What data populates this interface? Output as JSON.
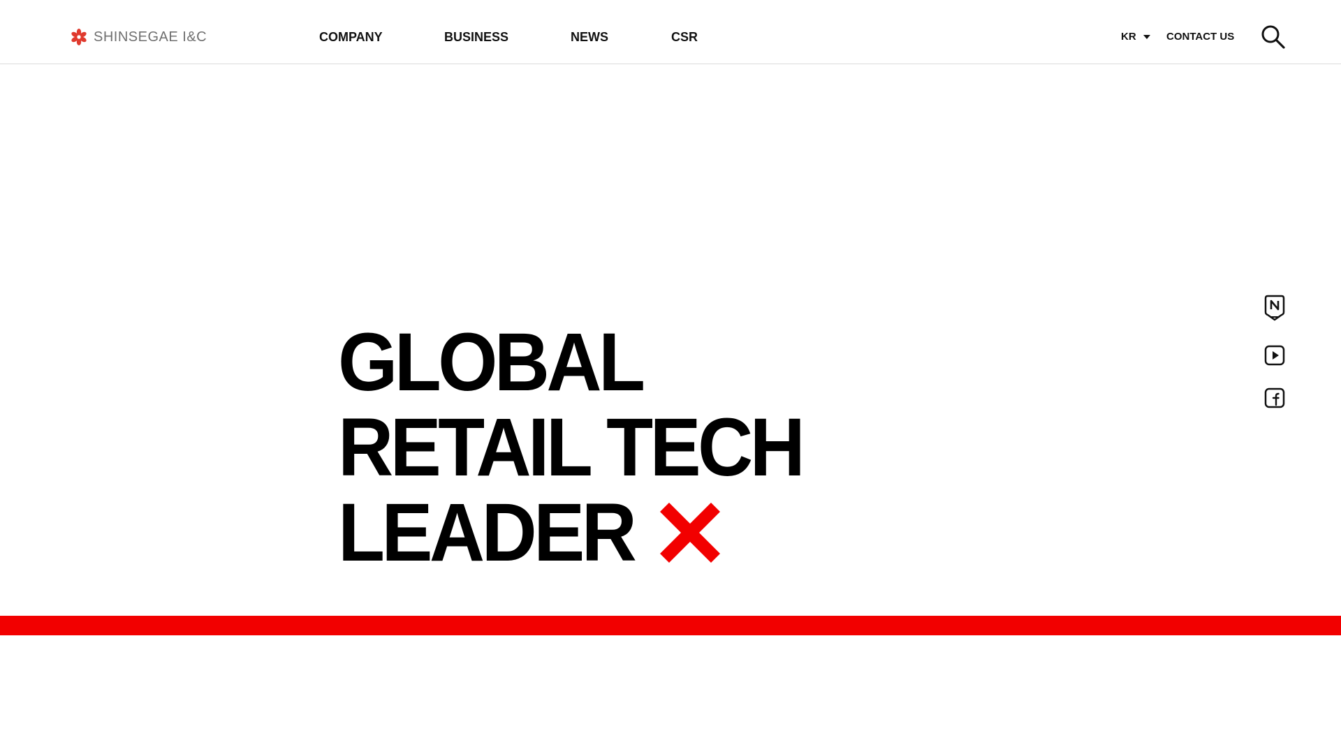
{
  "header": {
    "logo_text": "SHINSEGAE I&C",
    "nav": {
      "company": "COMPANY",
      "business": "BUSINESS",
      "news": "NEWS",
      "csr": "CSR"
    },
    "language": "KR",
    "contact": "CONTACT US"
  },
  "hero": {
    "line1": "GLOBAL",
    "line2": "RETAIL TECH",
    "line3": "LEADER"
  },
  "icons": {
    "logo": "flower-logo-icon",
    "language_caret": "caret-down-icon",
    "search": "search-icon",
    "hero_mark": "red-x-icon",
    "blog": "naver-blog-icon",
    "youtube": "youtube-icon",
    "facebook": "facebook-icon"
  },
  "colors": {
    "brand_red": "#f20000",
    "text": "#111111",
    "logo_gray": "#6f6f6f",
    "background": "#ffffff"
  }
}
